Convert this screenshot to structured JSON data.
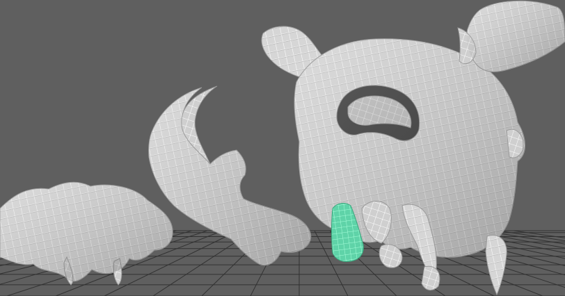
{
  "viewport": {
    "background": "#5f5f5f",
    "grid_color": "#2a2a2a",
    "mesh_fill": "#d9d9d9",
    "mesh_shadow": "#bdbdbd",
    "wire_color": "#ffffff",
    "selection_fill": "#5fd3a8",
    "selection_wire": "#9affd4"
  },
  "scene_objects": [
    {
      "id": "skull",
      "name": "skull-mesh"
    },
    {
      "id": "skull-horn",
      "name": "skull-horn-mesh"
    },
    {
      "id": "jaw-fragment",
      "name": "jaw-fragment-mesh"
    },
    {
      "id": "claw",
      "name": "claw-mesh"
    },
    {
      "id": "tooth-selected",
      "name": "selected-tooth-mesh"
    }
  ]
}
